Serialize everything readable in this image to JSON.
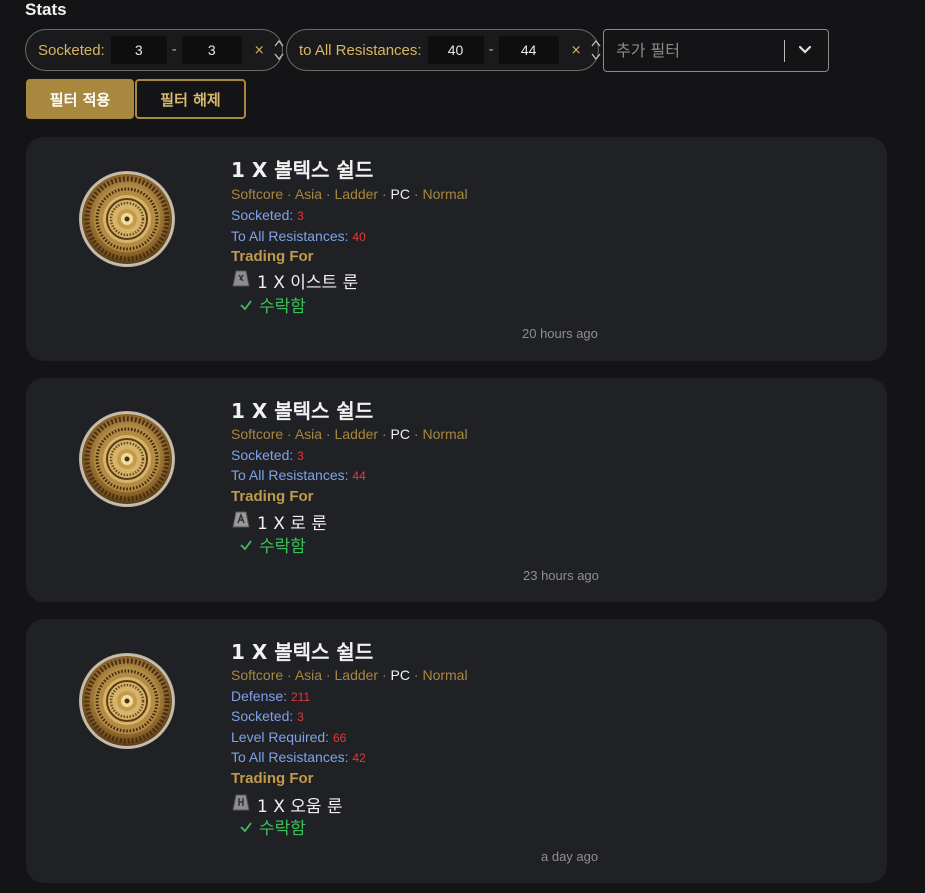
{
  "section_title": "Stats",
  "filters": [
    {
      "label": "Socketed:",
      "min": "3",
      "max": "3",
      "dash": "-",
      "clear": "×"
    },
    {
      "label": "to All Resistances:",
      "min": "40",
      "max": "44",
      "dash": "-",
      "clear": "×"
    }
  ],
  "add_filter": {
    "placeholder": "추가 필터"
  },
  "buttons": {
    "apply": "필터 적용",
    "reset": "필터 해제"
  },
  "listings": [
    {
      "title": "1 X 볼텍스 쉴드",
      "meta": {
        "mode": "Softcore",
        "region": "Asia",
        "ladder": "Ladder",
        "platform": "PC",
        "difficulty": "Normal",
        "sep": " · "
      },
      "stats": [
        {
          "label": "Socketed:",
          "value": "3"
        },
        {
          "label": "To All Resistances:",
          "value": "40"
        }
      ],
      "trading_for_label": "Trading For",
      "trade_item": "1 X 이스트 룬",
      "status": "수락함",
      "time": "20 hours ago"
    },
    {
      "title": "1 X 볼텍스 쉴드",
      "meta": {
        "mode": "Softcore",
        "region": "Asia",
        "ladder": "Ladder",
        "platform": "PC",
        "difficulty": "Normal",
        "sep": " · "
      },
      "stats": [
        {
          "label": "Socketed:",
          "value": "3"
        },
        {
          "label": "To All Resistances:",
          "value": "44"
        }
      ],
      "trading_for_label": "Trading For",
      "trade_item": "1 X 로 룬",
      "status": "수락함",
      "time": "23 hours ago"
    },
    {
      "title": "1 X 볼텍스 쉴드",
      "meta": {
        "mode": "Softcore",
        "region": "Asia",
        "ladder": "Ladder",
        "platform": "PC",
        "difficulty": "Normal",
        "sep": " · "
      },
      "stats": [
        {
          "label": "Defense:",
          "value": "211"
        },
        {
          "label": "Socketed:",
          "value": "3"
        },
        {
          "label": "Level Required:",
          "value": "66"
        },
        {
          "label": "To All Resistances:",
          "value": "42"
        }
      ],
      "trading_for_label": "Trading For",
      "trade_item": "1 X 오움 룬",
      "status": "수락함",
      "time": "a day ago"
    }
  ],
  "colors": {
    "accent_gold": "#a8873f",
    "label_gold": "#d9b562",
    "stat_blue": "#7fa2e8",
    "value_red": "#e03a3a",
    "accepted_green": "#3bbf5b",
    "card_bg": "#202124",
    "page_bg": "#141416"
  },
  "icons": {
    "item": "vortex-shield-icon",
    "rune": "rune-icon",
    "accepted": "checkmark-icon",
    "add_filter": "chevron-down-icon",
    "spinner": "spinner-arrows-icon"
  }
}
